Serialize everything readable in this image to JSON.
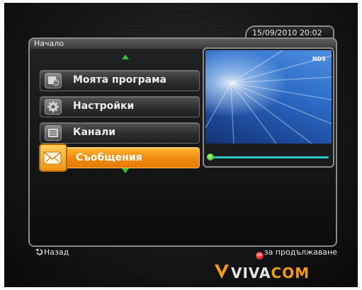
{
  "header": {
    "datetime": "15/09/2010 20:02"
  },
  "panel": {
    "breadcrumb": "Начало"
  },
  "menu": {
    "items": [
      {
        "label": "Моята програма",
        "icon": "my-program-icon",
        "selected": false
      },
      {
        "label": "Настройки",
        "icon": "settings-gear-icon",
        "selected": false
      },
      {
        "label": "Канали",
        "icon": "channels-icon",
        "selected": false
      },
      {
        "label": "Съобщения",
        "icon": "messages-envelope-icon",
        "selected": true
      }
    ]
  },
  "preview": {
    "logo": "NDS"
  },
  "footer": {
    "back_label": "Назад",
    "ok_badge": "OK",
    "ok_label": "за продължаване"
  },
  "brand": {
    "name_part1": "VIVA",
    "name_part2": "COM"
  },
  "colors": {
    "accent": "#f08a0c",
    "nav_arrow": "#35c13a",
    "progress": "#2ec4c0"
  }
}
